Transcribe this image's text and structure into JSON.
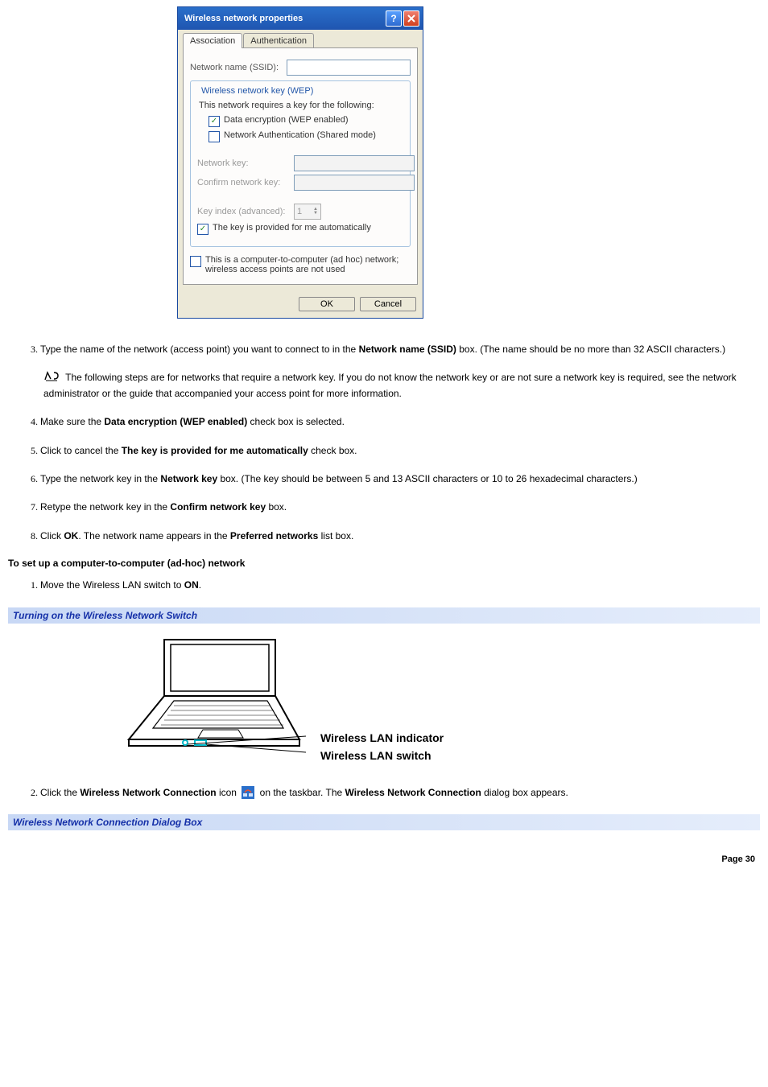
{
  "dialog": {
    "title": "Wireless network properties",
    "tabs": {
      "association": "Association",
      "authentication": "Authentication"
    },
    "ssid_label": "Network name (SSID):",
    "ssid_value": "",
    "wep_legend": "Wireless network key (WEP)",
    "wep_intro": "This network requires a key for the following:",
    "chk_data_encryption": "Data encryption (WEP enabled)",
    "chk_net_auth": "Network Authentication (Shared mode)",
    "network_key_label": "Network key:",
    "confirm_key_label": "Confirm network key:",
    "key_index_label": "Key index (advanced):",
    "key_index_value": "1",
    "chk_auto_key": "The key is provided for me automatically",
    "chk_adhoc": "This is a computer-to-computer (ad hoc) network; wireless access points are not used",
    "ok": "OK",
    "cancel": "Cancel"
  },
  "steps_a": {
    "s3_a": "Type the name of the network (access point) you want to connect to in the ",
    "s3_b": "Network name (SSID)",
    "s3_c": " box. (The name should be no more than 32 ASCII characters.)",
    "note": " The following steps are for networks that require a network key. If you do not know the network key or are not sure a network key is required, see the network administrator or the guide that accompanied your access point for more information.",
    "s4_a": "Make sure the ",
    "s4_b": "Data encryption (WEP enabled)",
    "s4_c": " check box is selected.",
    "s5_a": "Click to cancel the ",
    "s5_b": "The key is provided for me automatically",
    "s5_c": " check box.",
    "s6_a": "Type the network key in the ",
    "s6_b": "Network key",
    "s6_c": " box. (The key should be between 5 and 13 ASCII characters or 10 to 26 hexadecimal characters.)",
    "s7_a": "Retype the network key in the ",
    "s7_b": "Confirm network key",
    "s7_c": " box.",
    "s8_a": "Click ",
    "s8_b": "OK",
    "s8_c": ". The network name appears in the ",
    "s8_d": "Preferred networks",
    "s8_e": " list box."
  },
  "heading_adhoc": "To set up a computer-to-computer (ad-hoc) network",
  "steps_b": {
    "s1_a": "Move the Wireless LAN switch to ",
    "s1_b": "ON",
    "s1_c": ".",
    "s2_a": "Click the ",
    "s2_b": "Wireless Network Connection",
    "s2_c": " icon ",
    "s2_d": " on the taskbar. The ",
    "s2_e": "Wireless Network Connection",
    "s2_f": " dialog box appears."
  },
  "captions": {
    "switch": "Turning on the Wireless Network Switch",
    "dialog2": "Wireless Network Connection Dialog Box"
  },
  "annotations": {
    "indicator": "Wireless LAN indicator",
    "switch": "Wireless LAN switch"
  },
  "page_number": "Page 30"
}
